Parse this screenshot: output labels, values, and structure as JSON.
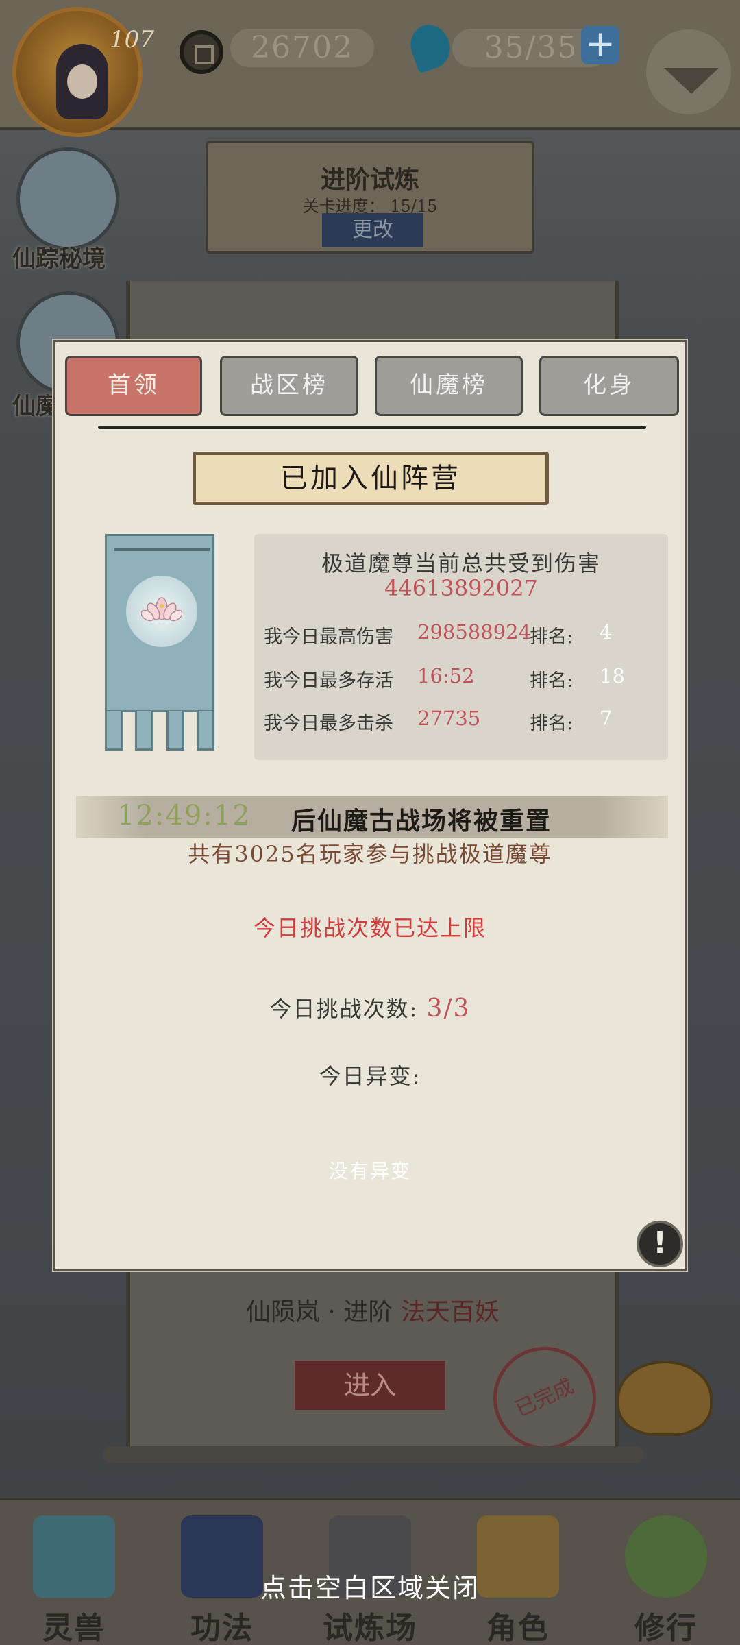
{
  "hud": {
    "level": "107",
    "gold": "26702",
    "energy": "35/35",
    "plus_icon": "+"
  },
  "side_buttons": [
    {
      "label": "仙踪秘境",
      "icon": "mountain-cloud-icon"
    },
    {
      "label": "仙魔",
      "icon": "dragon-icon"
    }
  ],
  "trial_scroll": {
    "title": "进阶试炼",
    "progress_label": "关卡进度：",
    "progress_value": "15/15",
    "change_button": "更改"
  },
  "stage": {
    "name": "仙陨岚 · 进阶",
    "difficulty": "法天百妖",
    "enter_button": "进入",
    "done_stamp": "已完成"
  },
  "modal": {
    "tabs": [
      {
        "label": "首领",
        "active": true
      },
      {
        "label": "战区榜",
        "active": false
      },
      {
        "label": "仙魔榜",
        "active": false
      },
      {
        "label": "化身",
        "active": false
      }
    ],
    "camp_status": "已加入仙阵营",
    "boss_damage_heading": "极道魔尊当前总共受到伤害",
    "boss_damage_total": "44613892027",
    "stats": [
      {
        "label": "我今日最高伤害",
        "value": "298588924",
        "rank_label": "排名:",
        "rank": "4"
      },
      {
        "label": "我今日最多存活",
        "value": "16:52",
        "rank_label": "排名:",
        "rank": "18"
      },
      {
        "label": "我今日最多击杀",
        "value": "27735",
        "rank_label": "排名:",
        "rank": "7"
      }
    ],
    "reset_timer": "12:49:12",
    "reset_text": "后仙魔古战场将被重置",
    "players_text": "共有3025名玩家参与挑战极道魔尊",
    "limit_text": "今日挑战次数已达上限",
    "challenge_count_label": "今日挑战次数:",
    "challenge_count_value": "3/3",
    "variant_title": "今日异变:",
    "variant_value": "没有异变",
    "info_icon": "!"
  },
  "bottom_nav": [
    {
      "label": "灵兽",
      "icon": "feather-icon"
    },
    {
      "label": "功法",
      "icon": "book-icon"
    },
    {
      "label": "试炼场",
      "icon": "mountain-icon"
    },
    {
      "label": "角色",
      "icon": "hat-icon"
    },
    {
      "label": "修行",
      "icon": "gourd-icon"
    }
  ],
  "close_hint": "点击空白区域关闭",
  "colors": {
    "active_tab": "#c97468",
    "inactive_tab": "#a09d98",
    "highlight_red": "#c1525a",
    "timer_green": "#8fa05a",
    "panel_bg": "#e9e5d9"
  }
}
